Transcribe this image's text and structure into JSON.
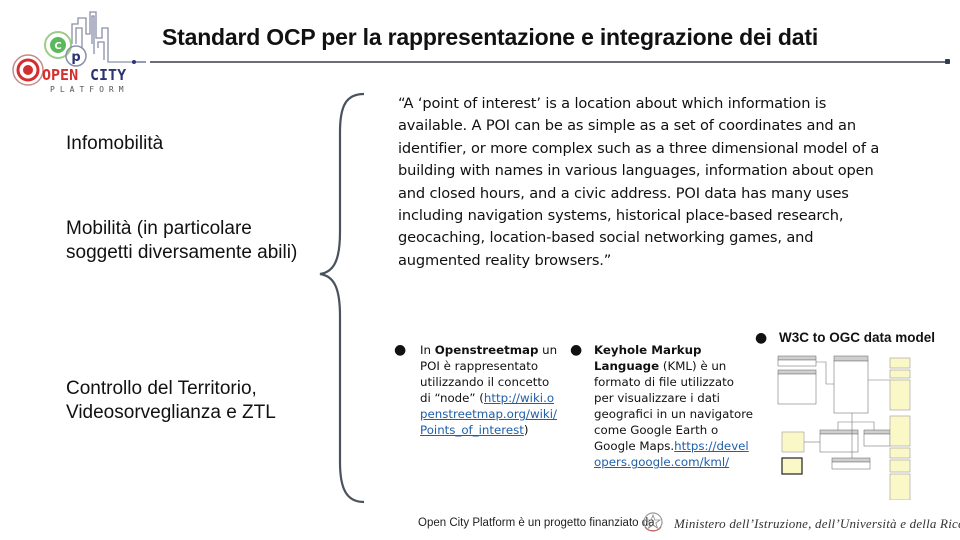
{
  "logo": {
    "brand_name": "OPEN CITY",
    "brand_sub": "PLATFORM",
    "colors": {
      "red": "#d32f2f",
      "green": "#5cb85c",
      "navy": "#2b3470",
      "gray": "#8a8fa8"
    }
  },
  "header": {
    "title": "Standard OCP per la rappresentazione e integrazione dei dati"
  },
  "left_labels": [
    "Infomobilità",
    "Mobilità (in particolare soggetti diversamente abili)",
    "Controllo del Territorio, Videosorveglianza e ZTL"
  ],
  "quote": {
    "text": "“A ‘point of interest’ is a location about which information is available. A POI can be as simple as a set of coordinates and an identifier, or more complex such as a three dimensional model of a building with names in various languages, information about open and closed hours, and a civic address. POI data has many uses including navigation systems, historical place-based research, geocaching, location-based social networking games, and augmented reality browsers.”"
  },
  "bullets": [
    {
      "prefix": "In ",
      "bold": "Openstreetmap",
      "text": " un POI è rappresentato utilizzando il concetto di “node” (",
      "link": "http://wiki.openstreetmap.org/wiki/Points_of_interest",
      "suffix": ")"
    },
    {
      "bold": "Keyhole Markup Language",
      "text": " (KML) è un formato di file utilizzato per visualizzare i dati geografici in un navigatore come Google Earth o Google Maps.",
      "link": "https://developers.google.com/kml/"
    },
    {
      "bold": "W3C to OGC data model"
    }
  ],
  "footer": {
    "text": "Open City Platform è un progetto finanziato da",
    "ministry": "Ministero dell’Istruzione, dell’Università e della Ricerca"
  },
  "colors": {
    "link": "#1f5fa8",
    "brace": "#4a525e",
    "rule": "#6e6e7a",
    "note_fill": "#fbf8c8"
  }
}
